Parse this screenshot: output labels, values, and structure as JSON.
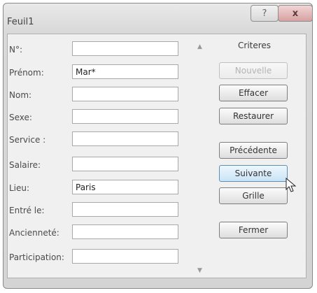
{
  "window": {
    "title": "Feuil1",
    "help_label": "?",
    "close_label": "x"
  },
  "form": {
    "fields": [
      {
        "label": "N°:",
        "value": ""
      },
      {
        "label": "Prénom:",
        "value": "Mar*"
      },
      {
        "label": "Nom:",
        "value": ""
      },
      {
        "label": "Sexe:",
        "value": ""
      },
      {
        "label": "Service :",
        "value": ""
      },
      {
        "label": "Salaire:",
        "value": ""
      },
      {
        "label": "Lieu:",
        "value": "Paris"
      },
      {
        "label": "Entré le:",
        "value": ""
      },
      {
        "label": "Ancienneté:",
        "value": ""
      },
      {
        "label": "Participation:",
        "value": ""
      }
    ]
  },
  "panel": {
    "heading": "Criteres",
    "buttons": {
      "nouvelle": "Nouvelle",
      "effacer": "Effacer",
      "restaurer": "Restaurer",
      "precedente": "Précédente",
      "suivante": "Suivante",
      "grille": "Grille",
      "fermer": "Fermer"
    }
  },
  "scroll": {
    "up_arrow": "▲",
    "down_arrow": "▼"
  }
}
